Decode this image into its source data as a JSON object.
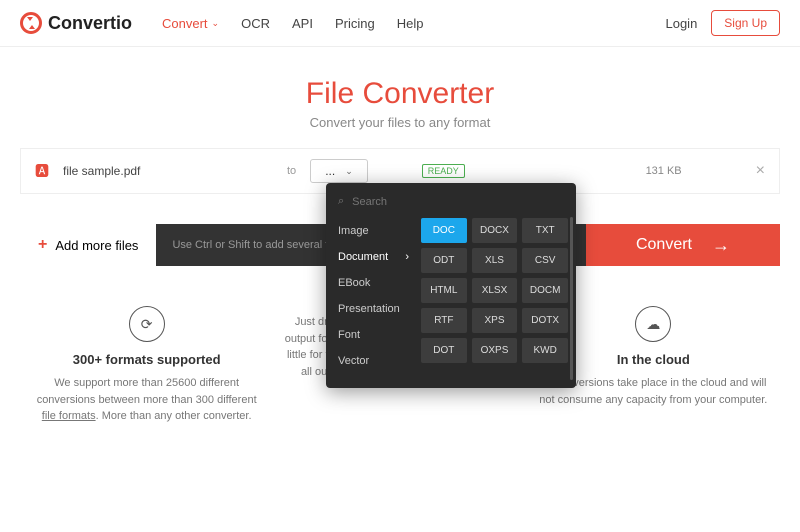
{
  "nav": {
    "brand": "Convertio",
    "links": {
      "convert": "Convert",
      "ocr": "OCR",
      "api": "API",
      "pricing": "Pricing",
      "help": "Help"
    },
    "login": "Login",
    "signup": "Sign Up"
  },
  "hero": {
    "title": "File Converter",
    "subtitle": "Convert your files to any format"
  },
  "file": {
    "name": "file sample.pdf",
    "to": "to",
    "selector": "...",
    "status": "READY",
    "size": "131 KB"
  },
  "actions": {
    "add_more": "Add more files",
    "hint": "Use Ctrl or Shift to add several fil",
    "convert": "Convert"
  },
  "dropdown": {
    "search_placeholder": "Search",
    "categories": [
      "Image",
      "Document",
      "EBook",
      "Presentation",
      "Font",
      "Vector"
    ],
    "active_category": "Document",
    "formats": [
      "DOC",
      "DOCX",
      "TXT",
      "ODT",
      "XLS",
      "CSV",
      "HTML",
      "XLSX",
      "DOCM",
      "RTF",
      "XPS",
      "DOTX",
      "DOT",
      "OXPS",
      "KWD"
    ],
    "selected": "DOC"
  },
  "features": {
    "f1": {
      "title": "300+ formats supported",
      "body_a": "We support more than 25600 different conversions between more than 300 different ",
      "link": "file formats",
      "body_b": ". More than any other converter."
    },
    "f2": {
      "title": "",
      "body": "Just drop your files on the page, choose an output format and click \"Convert\" button. Wait a little for the process to complete. We aim to do all our conversions in under 1-2 minutes."
    },
    "f3": {
      "title": "In the cloud",
      "body": "All conversions take place in the cloud and will not consume any capacity from your computer."
    }
  }
}
